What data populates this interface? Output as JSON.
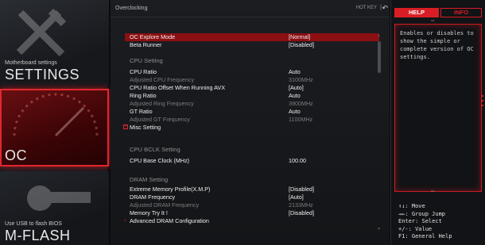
{
  "sidebar": {
    "settings": {
      "small": "Motherboard settings",
      "big": "SETTINGS"
    },
    "oc": {
      "big": "OC"
    },
    "mflash": {
      "small": "Use USB to flash BIOS",
      "big": "M-FLASH"
    }
  },
  "header": {
    "title": "Overclocking",
    "hotkey": "HOT KEY",
    "separator": "|",
    "back_icon": "↶"
  },
  "rows": [
    {
      "label": "OC Explore Mode",
      "value": "[Normal]",
      "state": "selected"
    },
    {
      "label": "Beta Runner",
      "value": "[Disabled]",
      "state": "normal"
    },
    {
      "label": "CPU  Setting",
      "value": "",
      "state": "section"
    },
    {
      "label": "CPU Ratio",
      "value": "Auto",
      "state": "normal"
    },
    {
      "label": "Adjusted CPU Frequency",
      "value": "3100MHz",
      "state": "dim"
    },
    {
      "label": "CPU Ratio Offset When Running AVX",
      "value": "[Auto]",
      "state": "normal"
    },
    {
      "label": "Ring Ratio",
      "value": "Auto",
      "state": "normal"
    },
    {
      "label": "Adjusted Ring Frequency",
      "value": "3900MHz",
      "state": "dim"
    },
    {
      "label": "GT Ratio",
      "value": "Auto",
      "state": "normal"
    },
    {
      "label": "Adjusted GT Frequency",
      "value": "1100MHz",
      "state": "dim"
    },
    {
      "label": "Misc Setting",
      "value": "",
      "state": "submenu-plus"
    },
    {
      "label": "CPU  BCLK  Setting",
      "value": "",
      "state": "section"
    },
    {
      "label": "CPU Base Clock (MHz)",
      "value": "100.00",
      "state": "normal"
    },
    {
      "label": "DRAM  Setting",
      "value": "",
      "state": "section"
    },
    {
      "label": "Extreme Memory Profile(X.M.P)",
      "value": "[Disabled]",
      "state": "normal"
    },
    {
      "label": "DRAM Frequency",
      "value": "[Auto]",
      "state": "normal"
    },
    {
      "label": "Adjusted DRAM Frequency",
      "value": "2133MHz",
      "state": "dim"
    },
    {
      "label": "Memory Try It !",
      "value": "[Disabled]",
      "state": "normal"
    },
    {
      "label": "Advanced DRAM Configuration",
      "value": "",
      "state": "submenu-arrow"
    }
  ],
  "help": {
    "tab_help": "HELP",
    "tab_info": "INFO",
    "text": "Enables or disables to show the simple or complete version of OC settings.",
    "keys": [
      "↑↓: Move",
      "→←: Group Jump",
      "Enter: Select",
      "+/-: Value",
      "F1: General Help"
    ]
  },
  "colors": {
    "accent": "#d81e24",
    "selected_row": "#8c0f12",
    "dim_text": "#7c7c7c"
  }
}
